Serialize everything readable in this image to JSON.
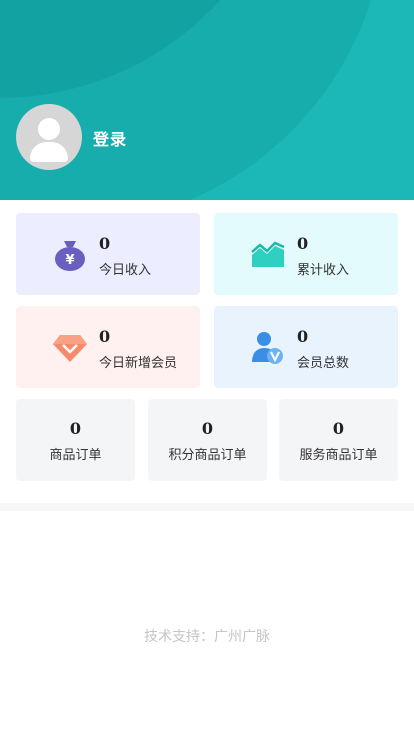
{
  "header": {
    "login_label": "登录",
    "bg_color": "#1cb8b8"
  },
  "stats": [
    {
      "value": "0",
      "label": "今日收入",
      "icon": "money-bag-icon",
      "bg": "#ecedfe"
    },
    {
      "value": "0",
      "label": "累计收入",
      "icon": "trend-chart-icon",
      "bg": "#e3fbfc"
    },
    {
      "value": "0",
      "label": "今日新增会员",
      "icon": "diamond-icon",
      "bg": "#fff1ef"
    },
    {
      "value": "0",
      "label": "会员总数",
      "icon": "vip-member-icon",
      "bg": "#e8f3fe"
    }
  ],
  "orders": [
    {
      "value": "0",
      "label": "商品订单"
    },
    {
      "value": "0",
      "label": "积分商品订单"
    },
    {
      "value": "0",
      "label": "服务商品订单"
    }
  ],
  "footer": {
    "text": "技术支持：广州广脉"
  }
}
